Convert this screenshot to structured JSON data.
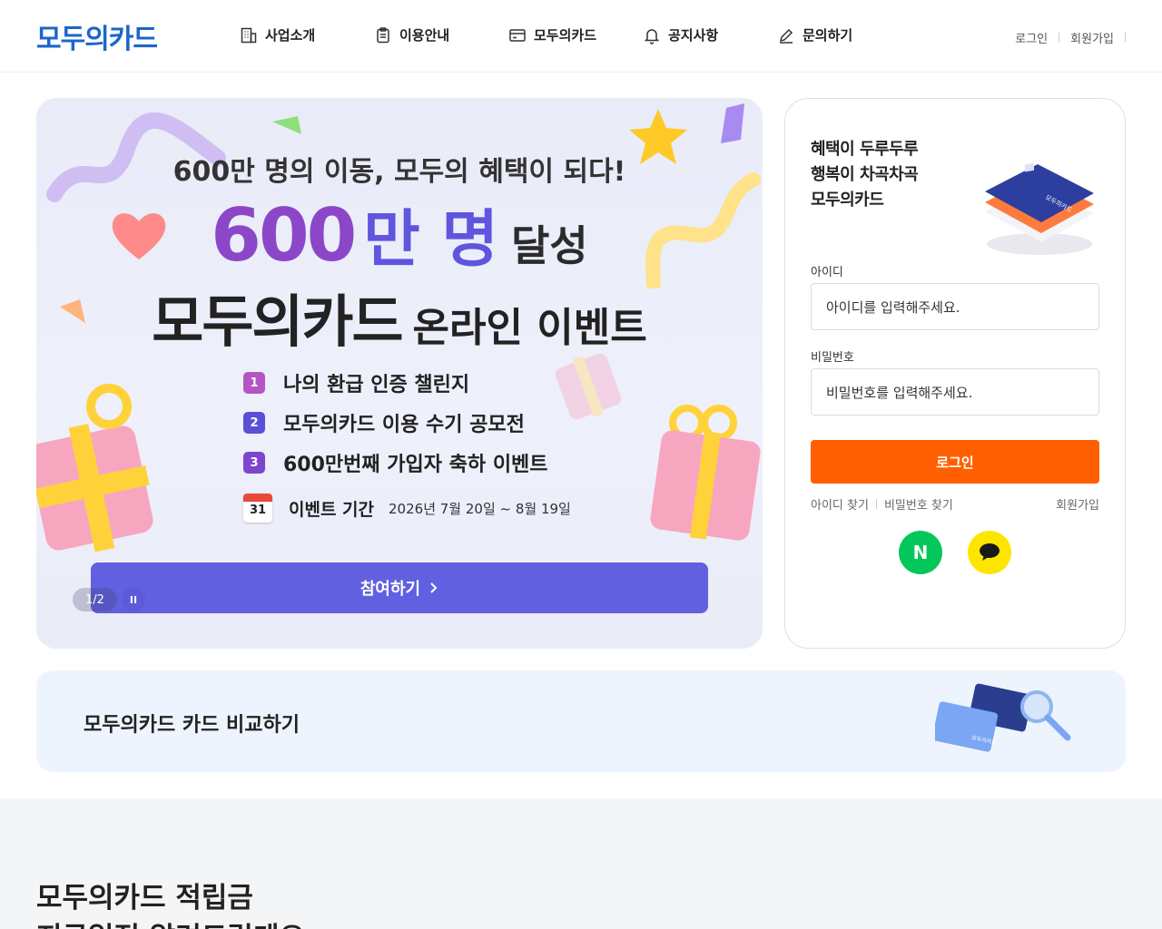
{
  "header": {
    "logo": "모두의카드",
    "nav": [
      {
        "label": "사업소개",
        "icon": "building-icon"
      },
      {
        "label": "이용안내",
        "icon": "clipboard-icon"
      },
      {
        "label": "모두의카드",
        "icon": "card-icon"
      },
      {
        "label": "공지사항",
        "icon": "bell-icon"
      },
      {
        "label": "문의하기",
        "icon": "pencil-icon"
      }
    ],
    "login": "로그인",
    "signup": "회원가입"
  },
  "banner": {
    "subtitle": "600만 명의 이동, 모두의 혜택이 되다!",
    "big_number": "600",
    "big_unit": "만 명",
    "achieved": "달성",
    "title_main": "모두의카드",
    "title_sub": "온라인 이벤트",
    "events": [
      {
        "num": "1",
        "label": "나의 환급 인증 챌린지",
        "color": "#b455c4"
      },
      {
        "num": "2",
        "label": "모두의카드 이용 수기 공모전",
        "color": "#5b4fd6"
      },
      {
        "num": "3",
        "label": "600만번째 가입자 축하 이벤트",
        "color": "#7d45d0"
      }
    ],
    "calendar_day": "31",
    "period_label": "이벤트 기간",
    "period_dates": "2026년 7월 20일 ~ 8월 19일",
    "join_button": "참여하기",
    "pager": "1/2",
    "pause": "II"
  },
  "login_panel": {
    "slogan": [
      "혜택이 두루두루",
      "행복이 차곡차곡",
      "모두의카드"
    ],
    "card_text": "모두의카드",
    "id_label": "아이디",
    "id_placeholder": "아이디를 입력해주세요.",
    "pw_label": "비밀번호",
    "pw_placeholder": "비밀번호를 입력해주세요.",
    "login_button": "로그인",
    "find_id": "아이디 찾기",
    "find_pw": "비밀번호 찾기",
    "signup": "회원가입",
    "naver": "N",
    "colors": {
      "accent": "#ff5f00",
      "naver": "#03c75a",
      "kakao": "#fee500"
    }
  },
  "compare": {
    "label": "모두의카드 카드 비교하기",
    "card_text": "모두의카드"
  },
  "section": {
    "title_line1": "모두의카드 적립금",
    "title_line2": "지급일정 알려드릴게요"
  }
}
